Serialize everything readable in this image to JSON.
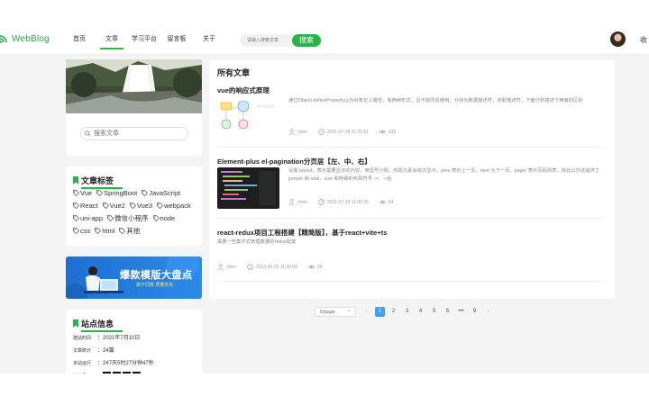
{
  "header": {
    "brand": "WebBlog",
    "nav": [
      {
        "label": "首页",
        "active": false
      },
      {
        "label": "文章",
        "active": true
      },
      {
        "label": "学习平台",
        "active": false
      },
      {
        "label": "留言板",
        "active": false
      },
      {
        "label": "关于",
        "active": false
      }
    ],
    "search_placeholder": "请输入搜索文章",
    "search_button": "搜索",
    "right_text": "收"
  },
  "sidebar": {
    "search_placeholder": "搜索文章",
    "tags_title": "文章标签",
    "tags": [
      "Vue",
      "SpringBoot",
      "JavaScript",
      "React",
      "Vue2",
      "Vue3",
      "webpack",
      "uni-app",
      "微信小程序",
      "node",
      "css",
      "html",
      "其他"
    ],
    "banner": {
      "title": "爆款模版大盘点",
      "subtitle": "高于同款 质量优先"
    },
    "info_title": "站点信息",
    "info": [
      {
        "key": "建站时间",
        "value": "2021年7月10日"
      },
      {
        "key": "文章统计",
        "value": "24篇"
      },
      {
        "key": "本站运行",
        "value": "247天5时27分钟47秒"
      },
      {
        "key": "微信号",
        "value": ""
      }
    ]
  },
  "main": {
    "title": "所有文章",
    "articles": [
      {
        "title": "vue的响应式原理",
        "desc": "通过Object.defineProperty以为对象定义属性，有两种形式，且不能同名使用，分别为数据描述符，存取描述符，下面分别描述下两者的区别",
        "author": "chen",
        "date": "2021-07-18 11:25:51",
        "views": "235"
      },
      {
        "title": "Element-plus el-pagination分页居【左、中、右】",
        "desc": "设置 layout，表示需要显示的内容，用逗号分隔，布局元素会依次显示。prev 表示上一页，next 为下一页，pager 表示页码列表，除此以外还提供了 jumper 和 total，size 和特殊的布局符号 ->，->后",
        "author": "chen",
        "date": "2021-07-16 11:00:26",
        "views": "54"
      },
      {
        "title": "react-redux项目工程搭建【精简版】，基于react+vite+ts",
        "desc": "需要一些集中式管理数据的redux配置",
        "author": "chen",
        "date": "2023-06-22 11:30:09",
        "views": "34"
      }
    ]
  },
  "pagination": {
    "per_page": "5/page",
    "pages": [
      "1",
      "2",
      "3",
      "4",
      "5",
      "6",
      "•••",
      "9"
    ],
    "current": "1"
  },
  "colors": {
    "accent": "#2bb34b",
    "pager_active": "#409eff"
  },
  "icons": [
    "wifi-logo-icon",
    "search-icon",
    "tag-icon",
    "user-icon",
    "clock-icon",
    "eye-icon",
    "bookmark-icon"
  ]
}
